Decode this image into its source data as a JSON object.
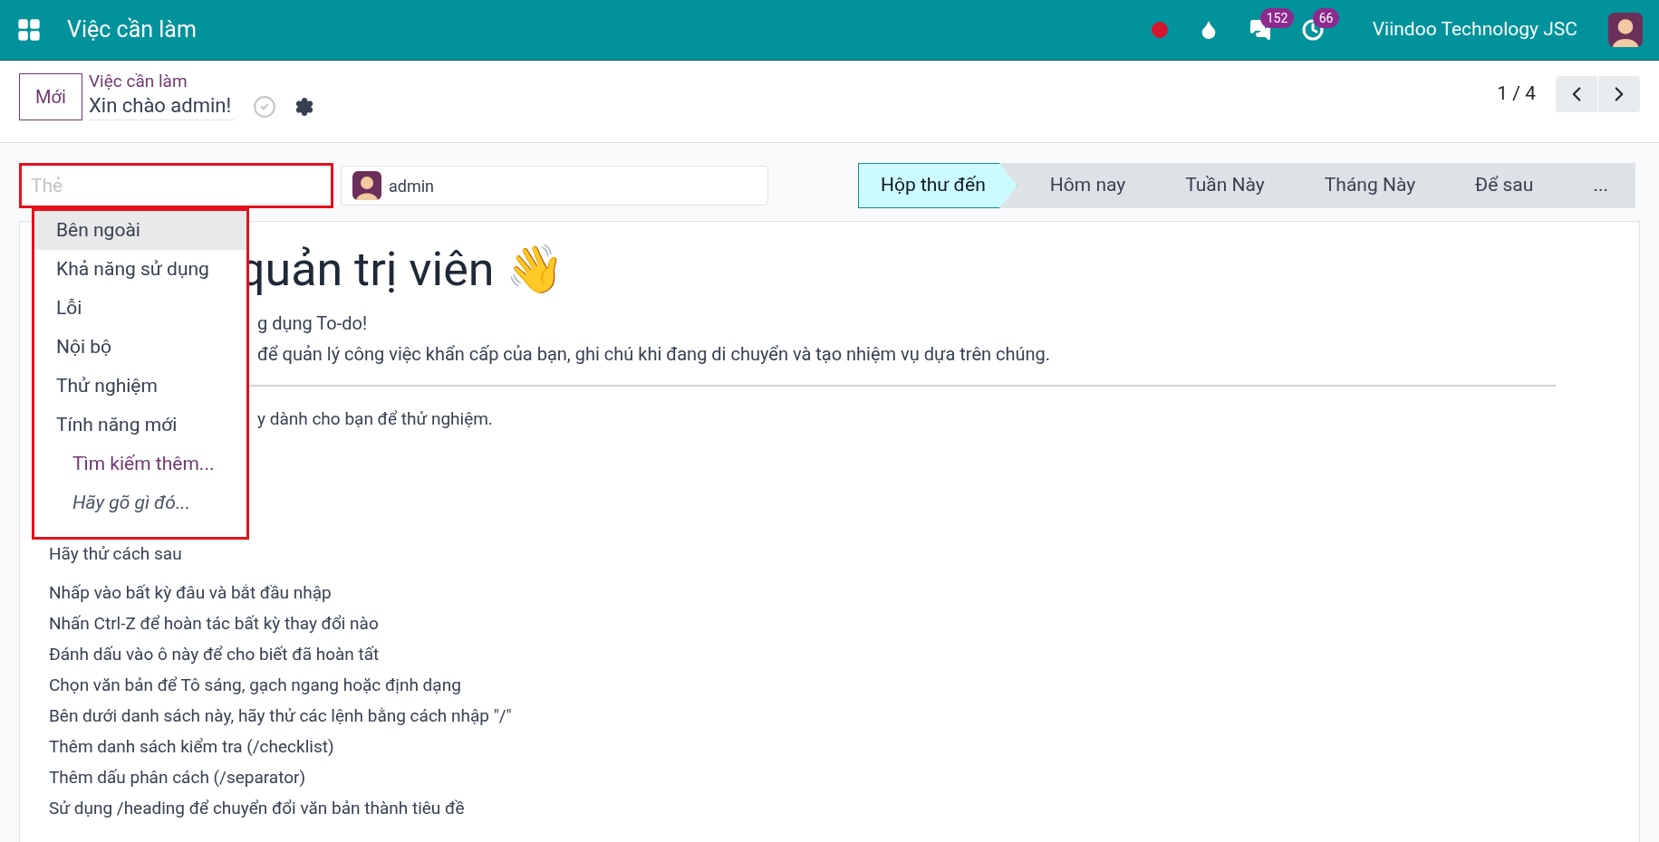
{
  "navbar": {
    "app_title": "Việc cần làm",
    "badges": [
      {
        "kind": "chat",
        "count": "152"
      },
      {
        "kind": "activity",
        "count": "66"
      }
    ],
    "company": "Viindoo Technology JSC"
  },
  "control_panel": {
    "new_button": "Mới",
    "breadcrumb": "Việc cần làm",
    "record_name": "Xin chào admin!",
    "pager": "1 / 4"
  },
  "tags_field": {
    "placeholder": "Thẻ"
  },
  "assignee": {
    "name": "admin"
  },
  "stages": [
    {
      "label": "Hộp thư đến",
      "selected": true
    },
    {
      "label": "Hôm nay",
      "selected": false
    },
    {
      "label": "Tuần Này",
      "selected": false
    },
    {
      "label": "Tháng Này",
      "selected": false
    },
    {
      "label": "Để sau",
      "selected": false
    },
    {
      "label": "...",
      "selected": false
    }
  ],
  "dropdown": [
    {
      "kind": "option",
      "label": "Bên ngoài",
      "selected": true
    },
    {
      "kind": "option",
      "label": "Khả năng sử dụng",
      "selected": false
    },
    {
      "kind": "option",
      "label": "Lỗi",
      "selected": false
    },
    {
      "kind": "option",
      "label": "Nội bộ",
      "selected": false
    },
    {
      "kind": "option",
      "label": "Thử nghiệm",
      "selected": false
    },
    {
      "kind": "option",
      "label": "Tính năng mới",
      "selected": false
    },
    {
      "kind": "link",
      "label": "Tìm kiếm thêm...",
      "selected": false
    },
    {
      "kind": "hint",
      "label": "Hãy gõ gì đó...",
      "selected": false
    }
  ],
  "note": {
    "heading": "quản trị viên 👋",
    "intro": [
      "g dụng To-do!",
      "để quản lý công việc khẩn cấp của bạn, ghi chú khi đang di chuyển và tạo nhiệm vụ dựa trên chúng."
    ],
    "after_rule": "y dành cho bạn để thử nghiệm.",
    "try_heading": "Hãy thử cách sau",
    "tips": [
      "Nhấp vào bất kỳ đâu và bắt đầu nhập",
      "Nhấn Ctrl-Z để hoàn tác bất kỳ thay đổi nào",
      "Đánh dấu vào ô này để cho biết đã hoàn tất",
      "Chọn văn bản để Tô sáng, gạch ngang hoặc định dạng",
      "Bên dưới danh sách này, hãy thử các lệnh bằng cách nhập \"/\"",
      "Thêm danh sách kiểm tra (/checklist)",
      "Thêm dấu phân cách (/separator)",
      "Sử dụng /heading để chuyển đổi văn bản thành tiêu đề"
    ]
  }
}
